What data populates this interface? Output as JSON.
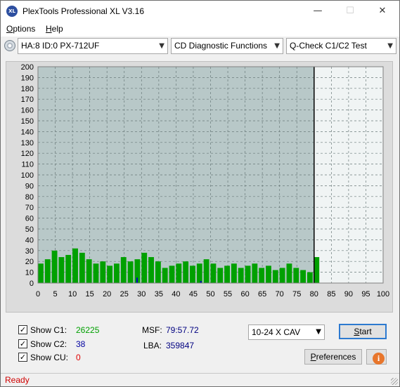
{
  "window": {
    "title": "PlexTools Professional XL V3.16",
    "app_icon_text": "XL",
    "minimize_glyph": "—",
    "maximize_glyph": "☐",
    "close_glyph": "✕"
  },
  "menu": {
    "options": {
      "first": "O",
      "rest": "ptions"
    },
    "help": {
      "first": "H",
      "rest": "elp"
    }
  },
  "toolbar": {
    "drive": "HA:8 ID:0  PX-712UF",
    "function": "CD Diagnostic Functions",
    "test": "Q-Check C1/C2 Test",
    "arrow": "▼"
  },
  "chart_data": {
    "type": "bar",
    "title": "",
    "xlabel": "",
    "ylabel": "",
    "xlim": [
      0,
      100
    ],
    "ylim": [
      0,
      200
    ],
    "xticks": [
      0,
      5,
      10,
      15,
      20,
      25,
      30,
      35,
      40,
      45,
      50,
      55,
      60,
      65,
      70,
      75,
      80,
      85,
      90,
      95,
      100
    ],
    "yticks": [
      0,
      10,
      20,
      30,
      40,
      50,
      60,
      70,
      80,
      90,
      100,
      110,
      120,
      130,
      140,
      150,
      160,
      170,
      180,
      190,
      200
    ],
    "grid": true,
    "data_end_x": 80,
    "colors": {
      "plot_background": "#b8c8c8",
      "plot_background_end": "#f0f4f4",
      "c1": "#00a000",
      "c2": "#0000c8",
      "end_marker": "#000000"
    },
    "series": [
      {
        "name": "C1",
        "x": [
          0,
          2,
          4,
          6,
          8,
          10,
          12,
          14,
          16,
          18,
          20,
          22,
          24,
          26,
          28,
          30,
          32,
          34,
          36,
          38,
          40,
          42,
          44,
          46,
          48,
          50,
          52,
          54,
          56,
          58,
          60,
          62,
          64,
          66,
          68,
          70,
          72,
          74,
          76,
          78,
          79.9
        ],
        "values": [
          18,
          22,
          30,
          24,
          26,
          32,
          28,
          22,
          18,
          20,
          16,
          18,
          24,
          20,
          22,
          28,
          24,
          20,
          14,
          16,
          18,
          20,
          16,
          18,
          22,
          18,
          14,
          16,
          18,
          14,
          16,
          18,
          14,
          16,
          12,
          14,
          18,
          14,
          12,
          10,
          24
        ]
      },
      {
        "name": "C2",
        "x": [
          28.5,
          47
        ],
        "values": [
          5,
          2
        ]
      }
    ]
  },
  "controls": {
    "show_c1": {
      "label": "Show C1:",
      "value": "26225",
      "color": "#00a000",
      "checked": true
    },
    "show_c2": {
      "label": "Show C2:",
      "value": "38",
      "color": "#0000a0",
      "checked": true
    },
    "show_cu": {
      "label": "Show CU:",
      "value": "0",
      "color": "#e00000",
      "checked": true
    },
    "msf_label": "MSF:",
    "msf_value": "79:57.72",
    "lba_label": "LBA:",
    "lba_value": "359847",
    "speed": "10-24 X CAV",
    "start": {
      "first": "S",
      "rest": "tart"
    },
    "preferences": {
      "first": "P",
      "rest": "references"
    },
    "info_glyph": "i",
    "check_glyph": "✓"
  },
  "status": {
    "text": "Ready"
  }
}
